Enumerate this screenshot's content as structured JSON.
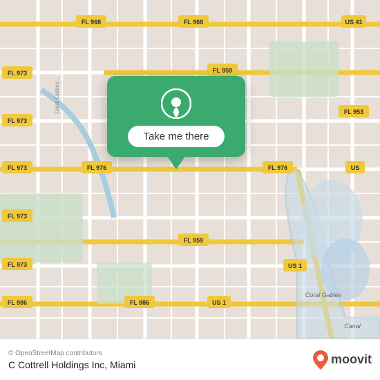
{
  "map": {
    "background_color": "#e8e0d8",
    "road_color": "#ffffff",
    "highway_color": "#f5d76e",
    "water_color": "#b8d4e8",
    "park_color": "#c8dfc8"
  },
  "popup": {
    "button_label": "Take me there",
    "background_color": "#3aaa6e"
  },
  "bottom_bar": {
    "copyright": "© OpenStreetMap contributors",
    "location_name": "C Cottrell Holdings Inc, Miami",
    "moovit_label": "moovit"
  },
  "route_labels": [
    {
      "id": "fl968_top_left",
      "text": "FL 968"
    },
    {
      "id": "fl968_top_right",
      "text": "FL 968"
    },
    {
      "id": "us41",
      "text": "US 41"
    },
    {
      "id": "fl973_left1",
      "text": "FL 973"
    },
    {
      "id": "fl959_top",
      "text": "FL 959"
    },
    {
      "id": "fl973_mid1",
      "text": "FL 973"
    },
    {
      "id": "fl953",
      "text": "FL 953"
    },
    {
      "id": "fl973_mid2",
      "text": "FL 973"
    },
    {
      "id": "fl976_left",
      "text": "FL 976"
    },
    {
      "id": "fl976_right",
      "text": "FL 976"
    },
    {
      "id": "us_right",
      "text": "US"
    },
    {
      "id": "fl973_low",
      "text": "FL 973"
    },
    {
      "id": "fl959_bottom",
      "text": "FL 959"
    },
    {
      "id": "us1_bottom",
      "text": "US 1"
    },
    {
      "id": "fl973_lowest",
      "text": "FL 973"
    },
    {
      "id": "fl986_left",
      "text": "FL 986"
    },
    {
      "id": "fl986_right",
      "text": "FL 986"
    },
    {
      "id": "coral_gables",
      "text": "Coral Gables"
    },
    {
      "id": "canal",
      "text": "Canal"
    }
  ]
}
